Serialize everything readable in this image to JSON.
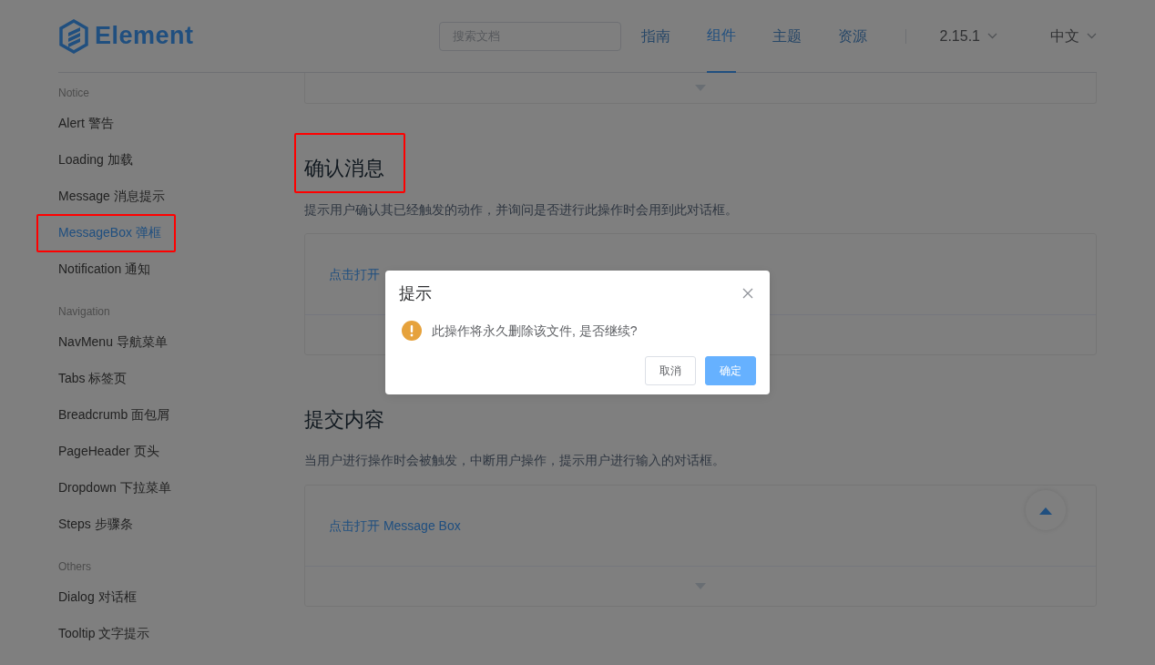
{
  "header": {
    "logo": "Element",
    "search": {
      "placeholder": "搜索文档"
    },
    "nav": [
      {
        "label": "指南",
        "selected": false
      },
      {
        "label": "组件",
        "selected": true
      },
      {
        "label": "主题",
        "selected": false
      },
      {
        "label": "资源",
        "selected": false
      }
    ],
    "version": "2.15.1",
    "language": "中文"
  },
  "sidebar": {
    "groups": [
      {
        "title": "Notice",
        "items": [
          {
            "label": "Alert 警告",
            "selected": false,
            "highlighted": false
          },
          {
            "label": "Loading 加载",
            "selected": false,
            "highlighted": false
          },
          {
            "label": "Message 消息提示",
            "selected": false,
            "highlighted": false
          },
          {
            "label": "MessageBox 弹框",
            "selected": true,
            "highlighted": true
          },
          {
            "label": "Notification 通知",
            "selected": false,
            "highlighted": false
          }
        ]
      },
      {
        "title": "Navigation",
        "items": [
          {
            "label": "NavMenu 导航菜单",
            "selected": false,
            "highlighted": false
          },
          {
            "label": "Tabs 标签页",
            "selected": false,
            "highlighted": false
          },
          {
            "label": "Breadcrumb 面包屑",
            "selected": false,
            "highlighted": false
          },
          {
            "label": "PageHeader 页头",
            "selected": false,
            "highlighted": false
          },
          {
            "label": "Dropdown 下拉菜单",
            "selected": false,
            "highlighted": false
          },
          {
            "label": "Steps 步骤条",
            "selected": false,
            "highlighted": false
          }
        ]
      },
      {
        "title": "Others",
        "items": [
          {
            "label": "Dialog 对话框",
            "selected": false,
            "highlighted": false
          },
          {
            "label": "Tooltip 文字提示",
            "selected": false,
            "highlighted": false
          }
        ]
      }
    ]
  },
  "sections": [
    {
      "title": "确认消息",
      "highlighted": true,
      "description": "提示用户确认其已经触发的动作，并询问是否进行此操作时会用到此对话框。",
      "demo": {
        "link": "点击打开"
      }
    },
    {
      "title": "提交内容",
      "highlighted": false,
      "description": "当用户进行操作时会被触发，中断用户操作，提示用户进行输入的对话框。",
      "demo": {
        "link": "点击打开 Message Box"
      }
    }
  ],
  "dialog": {
    "title": "提示",
    "message": "此操作将永久删除该文件, 是否继续?",
    "buttons": [
      {
        "label": "取消",
        "kind": "default"
      },
      {
        "label": "确定",
        "kind": "primary"
      }
    ]
  }
}
